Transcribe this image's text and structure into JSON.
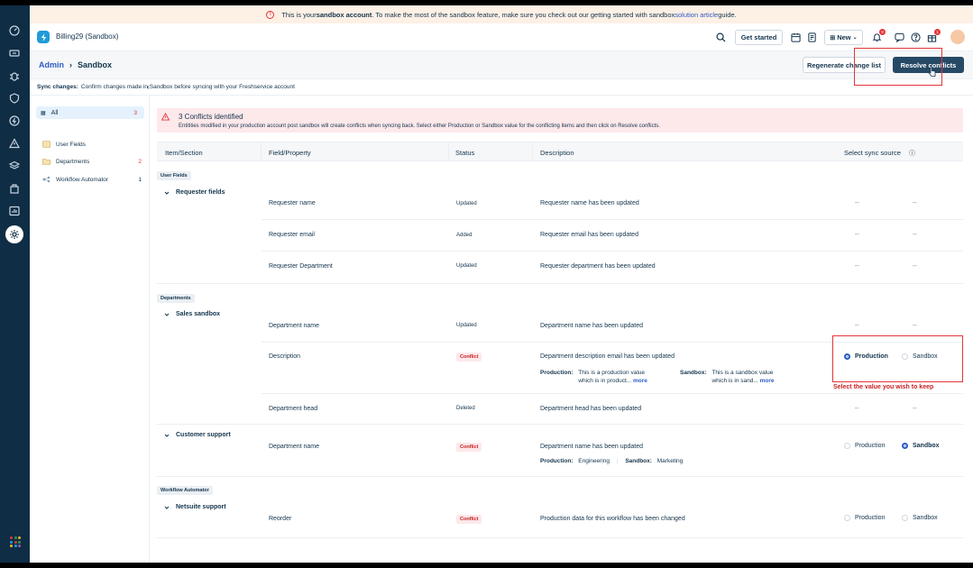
{
  "notice": {
    "pre": "This is your ",
    "bold": "sandbox account",
    "mid": ". To make the most of the sandbox feature, make sure you check out our getting started with sandbox ",
    "link": "solution article",
    "post": " guide."
  },
  "header": {
    "account_name": "Billing29 (Sandbox)",
    "get_started_label": "Get started",
    "new_label": "New",
    "notification_count": "9",
    "gift_count": "1"
  },
  "breadcrumb": {
    "parent": "Admin",
    "current": "Sandbox"
  },
  "actions": {
    "regenerate_label": "Regenerate change list",
    "resolve_label": "Resolve conflicts"
  },
  "sync_info": {
    "label": "Sync changes:",
    "text": "Confirm changes made in Sandbox before syncing with your Freshservice account"
  },
  "sidebar": {
    "all": {
      "label": "All",
      "count": "3"
    },
    "items": [
      {
        "label": "User Fields",
        "count": ""
      },
      {
        "label": "Departments",
        "count": "2"
      },
      {
        "label": "Workflow Automator",
        "count": "1"
      }
    ]
  },
  "alert": {
    "title": "3 Conflicts identified",
    "text": "Entitities modified in your production account post sandbox will create conflicts when syncing back. Select either Production or Sandbox value for the conflicting items and then click on Resolve conflicts."
  },
  "table": {
    "headers": [
      "Item/Section",
      "Field/Property",
      "Status",
      "Description",
      "Select sync source"
    ],
    "sections": {
      "user_fields": "User Fields",
      "departments": "Departments",
      "workflow": "Workflow Automator"
    },
    "groups": {
      "requester_fields": "Requester fields",
      "sales_sandbox": "Sales sandbox",
      "customer_support": "Customer support",
      "netsuite_support": "Netsuite support"
    },
    "rows": [
      {
        "field": "Requester name",
        "status": "Updated",
        "description": "Requester name has been updated"
      },
      {
        "field": "Requester email",
        "status": "Added",
        "description": "Requester email has been updated"
      },
      {
        "field": "Requester Department",
        "status": "Updated",
        "description": "Requester department has been updated"
      },
      {
        "field": "Department name",
        "status": "Updated",
        "description": "Department name has been updated"
      },
      {
        "field": "Description",
        "status": "Conflict",
        "description": "Department description email has been updated"
      },
      {
        "field": "Department head",
        "status": "Deleted",
        "description": "Department head has been updated"
      },
      {
        "field": "Department name",
        "status": "Conflict",
        "description": "Department name has been updated"
      },
      {
        "field": "Reorder",
        "status": "Conflict",
        "description": "Production data for this workflow has been changed"
      }
    ],
    "dash": "--",
    "production_label": "Production",
    "sandbox_label": "Sandbox",
    "more_label": "more",
    "description_detail": {
      "prod_label": "Production:",
      "prod_line1": "This is a production value",
      "prod_line2": "which is in product...",
      "sand_label": "Sandbox:",
      "sand_line1": "This is a sandbox value",
      "sand_line2": "which is in sand..."
    },
    "customer_detail": {
      "prod_label": "Production:",
      "prod_value": "Engineering",
      "sand_label": "Sandbox:",
      "sand_value": "Marketing"
    }
  },
  "annotation": {
    "select_note": "Select the value you wish to keep"
  },
  "colors": {
    "nav": "#0f2d45",
    "primary_button": "#264966",
    "conflict": "#c82124",
    "highlight": "#e43538",
    "link": "#2c5cc5"
  }
}
